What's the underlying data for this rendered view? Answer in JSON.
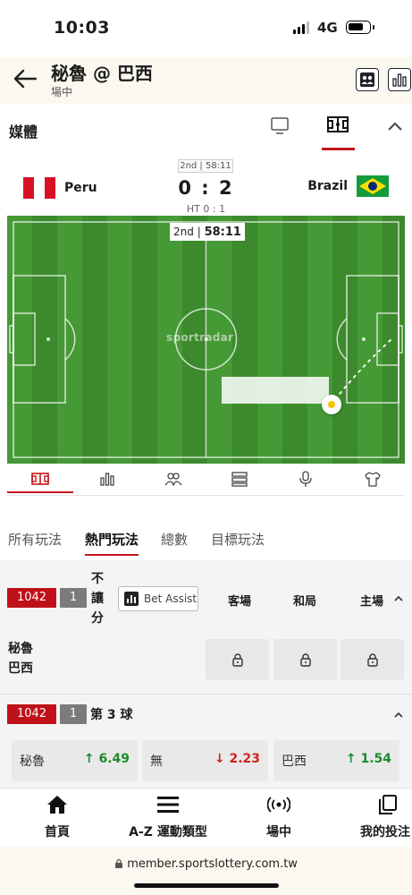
{
  "status_bar": {
    "time": "10:03",
    "network": "4G"
  },
  "header": {
    "title": "秘魯 @ 巴西",
    "subtitle": "場中"
  },
  "media": {
    "label": "媒體"
  },
  "match": {
    "period_badge": "2nd | 58:11",
    "home_team": "Peru",
    "away_team": "Brazil",
    "score": "0 : 2",
    "halftime": "HT 0 : 1",
    "pitch_period": "2nd",
    "pitch_clock": "58:11",
    "provider": "sportradar"
  },
  "bet_tabs": [
    "所有玩法",
    "熱門玩法",
    "總數",
    "目標玩法"
  ],
  "market1": {
    "code": "1042",
    "num": "1",
    "name_chars": [
      "不",
      "讓",
      "分"
    ],
    "bet_assist": "Bet Assist",
    "col_away": "客場",
    "col_draw": "和局",
    "col_home": "主場",
    "team1": "秘魯",
    "team2": "巴西"
  },
  "market2": {
    "code": "1042",
    "num": "1",
    "title": "第 3 球",
    "odds": [
      {
        "label": "秘魯",
        "value": "6.49",
        "dir": "up"
      },
      {
        "label": "無",
        "value": "2.23",
        "dir": "down"
      },
      {
        "label": "巴西",
        "value": "1.54",
        "dir": "up"
      }
    ]
  },
  "colors": {
    "accent": "#c4161c",
    "up": "#1a8c2e",
    "down": "#d42020",
    "pitch": "#3f8f2f"
  },
  "bottom_nav": [
    "首頁",
    "A-Z 運動類型",
    "場中",
    "我的投注"
  ],
  "url": "member.sportslottery.com.tw",
  "icons": [
    "back-arrow-icon",
    "stats-icon",
    "tv-icon",
    "pitch-icon",
    "chevron-up-icon",
    "lock-icon",
    "home-icon",
    "menu-icon",
    "live-icon",
    "bets-icon"
  ]
}
